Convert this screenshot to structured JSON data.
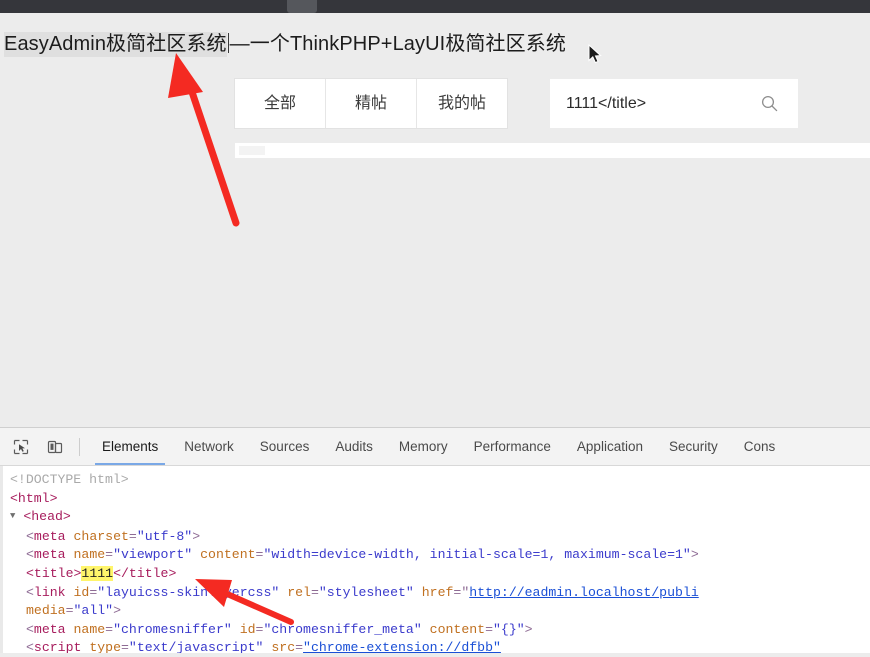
{
  "browser": {
    "tab_strip_color": "#35363b"
  },
  "web_page": {
    "title_main": "EasyAdmin极简社区系统",
    "title_separator": "—",
    "title_sub": "一个ThinkPHP+LayUI极简社区系统",
    "nav_tabs": [
      {
        "label": "全部"
      },
      {
        "label": "精帖"
      },
      {
        "label": "我的帖"
      }
    ],
    "search": {
      "value": "1111</title>",
      "placeholder": "",
      "icon": "search-icon"
    }
  },
  "devtools": {
    "toolbar_icons": [
      {
        "name": "inspect-element-icon"
      },
      {
        "name": "toggle-device-toolbar-icon"
      }
    ],
    "tabs": [
      {
        "label": "Elements",
        "active": true
      },
      {
        "label": "Network",
        "active": false
      },
      {
        "label": "Sources",
        "active": false
      },
      {
        "label": "Audits",
        "active": false
      },
      {
        "label": "Memory",
        "active": false
      },
      {
        "label": "Performance",
        "active": false
      },
      {
        "label": "Application",
        "active": false
      },
      {
        "label": "Security",
        "active": false
      },
      {
        "label": "Cons",
        "active": false
      }
    ],
    "active_tab_underline_color": "#7aa8e6",
    "dom": {
      "l0_doctype": "<!DOCTYPE html>",
      "l1_html_open": "<html>",
      "l2_head_tag": "<head>",
      "l3_meta_charset_tag": "meta",
      "l3_meta_charset_attr": "charset",
      "l3_meta_charset_val": "\"utf-8\"",
      "l4_meta_viewport_tag": "meta",
      "l4_meta_viewport_attr_name": "name",
      "l4_meta_viewport_val_name": "\"viewport\"",
      "l4_meta_viewport_attr_content": "content",
      "l4_meta_viewport_val_content": "\"width=device-width, initial-scale=1, maximum-scale=1\"",
      "l5_title_open": "<title>",
      "l5_title_text": "1111",
      "l5_title_close": "</title>",
      "l6_link_tag": "link",
      "l6_link_attr_id": "id",
      "l6_link_val_id": "\"layuicss-skinlayercss\"",
      "l6_link_attr_rel": "rel",
      "l6_link_val_rel": "\"stylesheet\"",
      "l6_link_attr_href": "href",
      "l6_link_val_href": "http://eadmin.localhost/publi",
      "l7_media_attr": "media",
      "l7_media_val": "\"all\"",
      "l8_meta_sniffer_tag": "meta",
      "l8_meta_sniffer_attr_name": "name",
      "l8_meta_sniffer_val_name": "\"chromesniffer\"",
      "l8_meta_sniffer_attr_id": "id",
      "l8_meta_sniffer_val_id": "\"chromesniffer_meta\"",
      "l8_meta_sniffer_attr_content": "content",
      "l8_meta_sniffer_val_content": "\"{}\"",
      "l9_script_tag": "script",
      "l9_script_attr_type": "type",
      "l9_script_val_type": "\"text/javascript\"",
      "l9_script_attr_src": "src",
      "l9_script_val_src": "\"chrome-extension://dfbb\"",
      "highlight_color": "#fff56b"
    }
  },
  "annotations": {
    "arrow_color": "#f42a22",
    "arrow_1": {
      "name": "arrow-pointing-to-page-title"
    },
    "arrow_2": {
      "name": "arrow-pointing-to-title-element"
    },
    "cursor": {
      "name": "mouse-cursor"
    }
  }
}
